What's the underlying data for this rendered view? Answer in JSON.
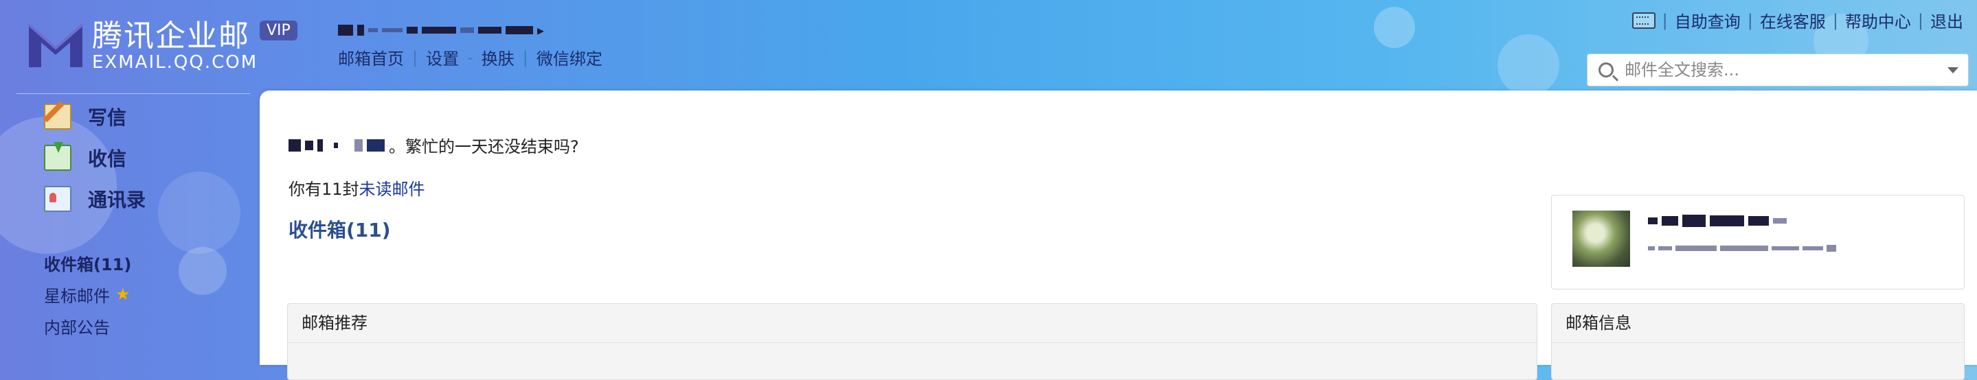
{
  "app": {
    "logo_cn": "腾讯企业邮",
    "logo_en": "EXMAIL.QQ.COM",
    "vip_badge": "VIP"
  },
  "header": {
    "nav": [
      "邮箱首页",
      "设置",
      "换肤",
      "微信绑定"
    ],
    "nav_separators": [
      "|",
      "-",
      "|"
    ],
    "links": [
      "自助查询",
      "在线客服",
      "帮助中心",
      "退出"
    ],
    "keyboard_icon": "keyboard-icon"
  },
  "search": {
    "placeholder": "邮件全文搜索..."
  },
  "sidebar": {
    "actions": [
      {
        "label": "写信",
        "icon": "compose-icon"
      },
      {
        "label": "收信",
        "icon": "inbox-download-icon"
      },
      {
        "label": "通讯录",
        "icon": "contacts-icon"
      }
    ],
    "folders": [
      {
        "label": "收件箱(11)"
      },
      {
        "label": "星标邮件"
      },
      {
        "label": "内部公告"
      }
    ]
  },
  "main": {
    "greeting_suffix": "。繁忙的一天还没结束吗?",
    "unread_prefix": "你有11封",
    "unread_link": "未读邮件",
    "inbox_title": "收件箱(11)",
    "recommend_header": "邮箱推荐",
    "mailinfo_header": "邮箱信息"
  },
  "colors": {
    "accent": "#2a4f8f",
    "link": "#1a3a9a",
    "header_bg": "#4aa6ec"
  }
}
